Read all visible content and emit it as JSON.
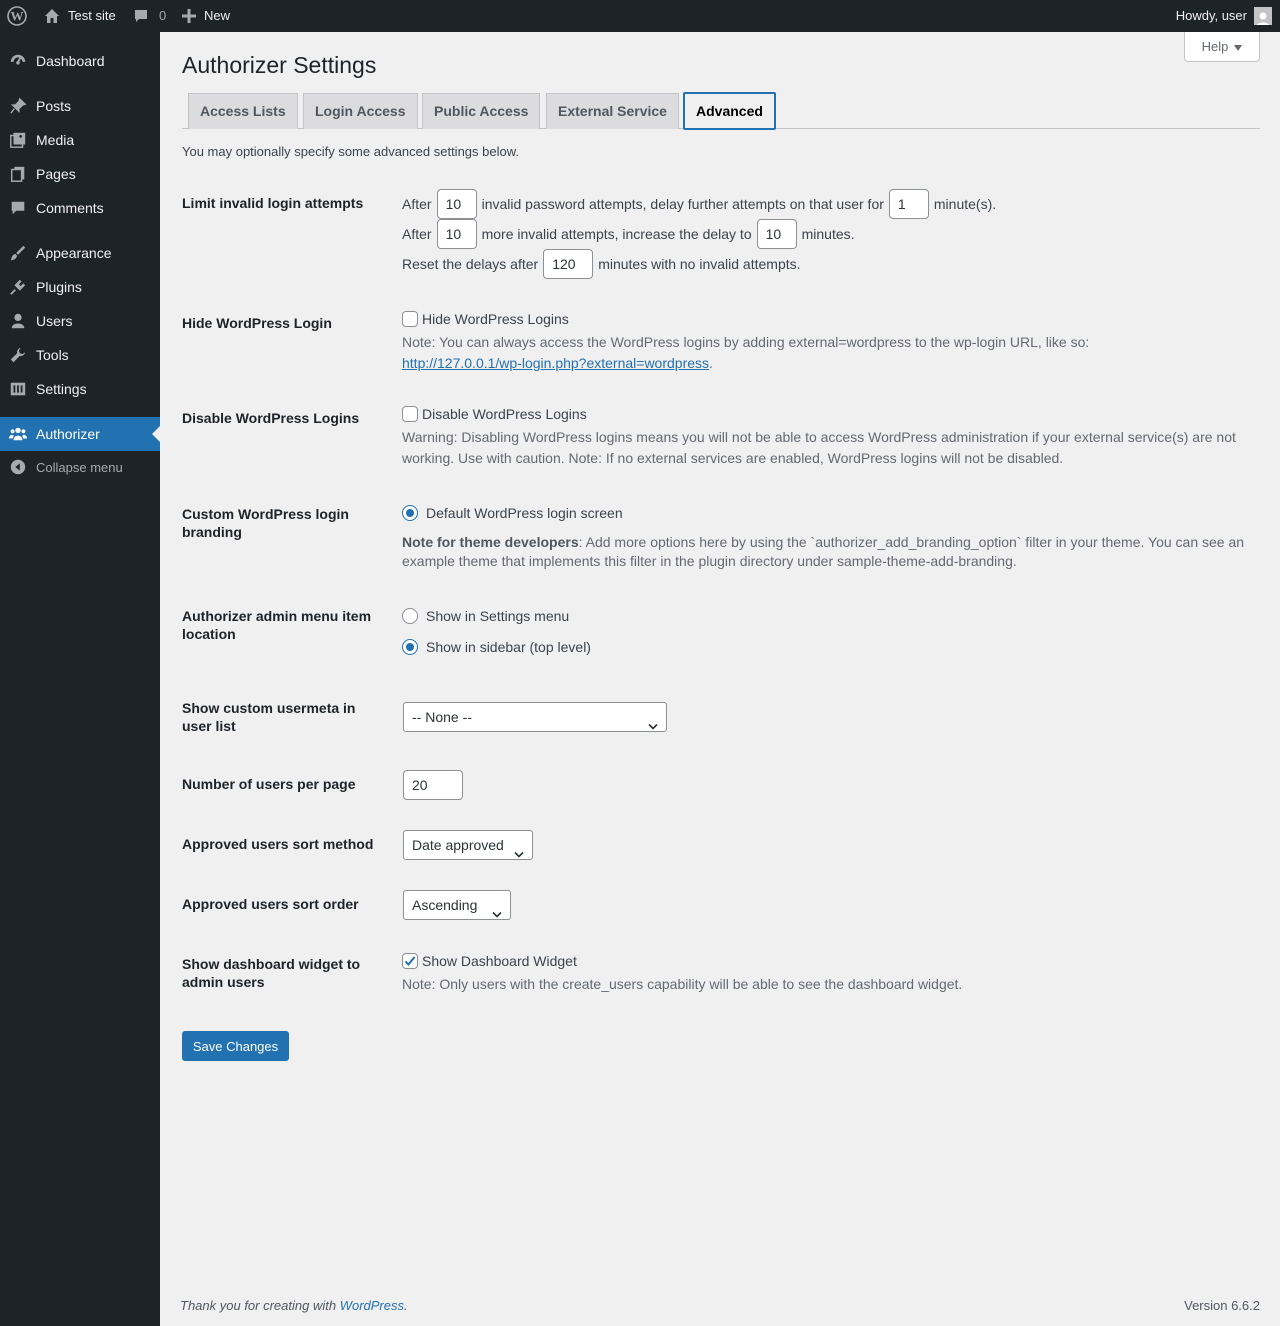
{
  "adminbar": {
    "site_name": "Test site",
    "comments_count": "0",
    "new_label": "New",
    "howdy": "Howdy, user"
  },
  "sidebar": {
    "items": [
      {
        "label": "Dashboard",
        "icon": "dashboard-icon"
      },
      {
        "label": "Posts",
        "icon": "pin-icon"
      },
      {
        "label": "Media",
        "icon": "media-icon"
      },
      {
        "label": "Pages",
        "icon": "pages-icon"
      },
      {
        "label": "Comments",
        "icon": "comment-icon"
      },
      {
        "label": "Appearance",
        "icon": "brush-icon"
      },
      {
        "label": "Plugins",
        "icon": "plug-icon"
      },
      {
        "label": "Users",
        "icon": "user-icon"
      },
      {
        "label": "Tools",
        "icon": "wrench-icon"
      },
      {
        "label": "Settings",
        "icon": "settings-icon"
      },
      {
        "label": "Authorizer",
        "icon": "groups-icon"
      }
    ],
    "collapse_label": "Collapse menu"
  },
  "help_label": "Help",
  "page_title": "Authorizer Settings",
  "tabs": [
    "Access Lists",
    "Login Access",
    "Public Access",
    "External Service",
    "Advanced"
  ],
  "active_tab": "Advanced",
  "intro": "You may optionally specify some advanced settings below.",
  "limit": {
    "label": "Limit invalid login attempts",
    "after1": "After",
    "attempts1": "10",
    "text1": "invalid password attempts, delay further attempts on that user for",
    "delay1": "1",
    "unit1": "minute(s).",
    "after2": "After",
    "attempts2": "10",
    "text2": "more invalid attempts, increase the delay to",
    "delay2": "10",
    "unit2": "minutes.",
    "reset_prefix": "Reset the delays after",
    "reset_value": "120",
    "reset_suffix": "minutes with no invalid attempts."
  },
  "hide_login": {
    "label": "Hide WordPress Login",
    "checkbox": "Hide WordPress Logins",
    "checked": false,
    "note": "Note: You can always access the WordPress logins by adding external=wordpress to the wp-login URL, like so:",
    "link": "http://127.0.0.1/wp-login.php?external=wordpress",
    "link_suffix": "."
  },
  "disable_login": {
    "label": "Disable WordPress Logins",
    "checkbox": "Disable WordPress Logins",
    "checked": false,
    "warning": "Warning: Disabling WordPress logins means you will not be able to access WordPress administration if your external service(s) are not working. Use with caution. Note: If no external services are enabled, WordPress logins will not be disabled."
  },
  "branding": {
    "label": "Custom WordPress login branding",
    "option": "Default WordPress login screen",
    "note_bold": "Note for theme developers",
    "note": ": Add more options here by using the `authorizer_add_branding_option` filter in your theme. You can see an example theme that implements this filter in the plugin directory under sample-theme-add-branding."
  },
  "menu_location": {
    "label": "Authorizer admin menu item location",
    "options": [
      "Show in Settings menu",
      "Show in sidebar (top level)"
    ],
    "selected": "Show in sidebar (top level)"
  },
  "usermeta": {
    "label": "Show custom usermeta in user list",
    "value": "-- None --"
  },
  "users_per_page": {
    "label": "Number of users per page",
    "value": "20"
  },
  "sort_method": {
    "label": "Approved users sort method",
    "value": "Date approved"
  },
  "sort_order": {
    "label": "Approved users sort order",
    "value": "Ascending"
  },
  "dashboard_widget": {
    "label": "Show dashboard widget to admin users",
    "checkbox": "Show Dashboard Widget",
    "checked": true,
    "note": "Note: Only users with the create_users capability will be able to see the dashboard widget."
  },
  "save_label": "Save Changes",
  "footer": {
    "thanks_prefix": "Thank you for creating with",
    "thanks_link": "WordPress",
    "thanks_suffix": ".",
    "version": "Version 6.6.2"
  },
  "colors": {
    "accent": "#2271b1",
    "adminbar_bg": "#1d2327",
    "page_bg": "#f0f0f1"
  }
}
